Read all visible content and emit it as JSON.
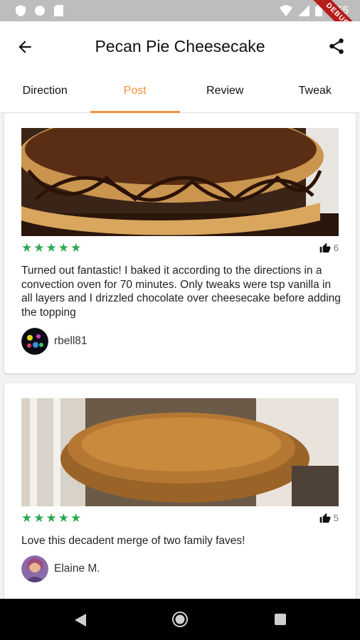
{
  "status": {
    "time": "5:55",
    "debug_label": "DEBUG"
  },
  "header": {
    "title": "Pecan Pie Cheesecake"
  },
  "tabs": [
    {
      "label": "Direction"
    },
    {
      "label": "Post"
    },
    {
      "label": "Review"
    },
    {
      "label": "Tweak"
    }
  ],
  "posts": [
    {
      "rating": 5,
      "likes": "6",
      "text": "Turned out fantastic! I baked it according to the directions in a convection oven for 70 minutes. Only tweaks were tsp vanilla in all layers and I drizzled chocolate over cheesecake before adding the topping",
      "user": "rbell81"
    },
    {
      "rating": 5,
      "likes": "5",
      "text": "Love this decadent merge of two family faves!",
      "user": "Elaine M."
    }
  ],
  "colors": {
    "accent": "#f5913f",
    "star": "#2fa84f"
  }
}
